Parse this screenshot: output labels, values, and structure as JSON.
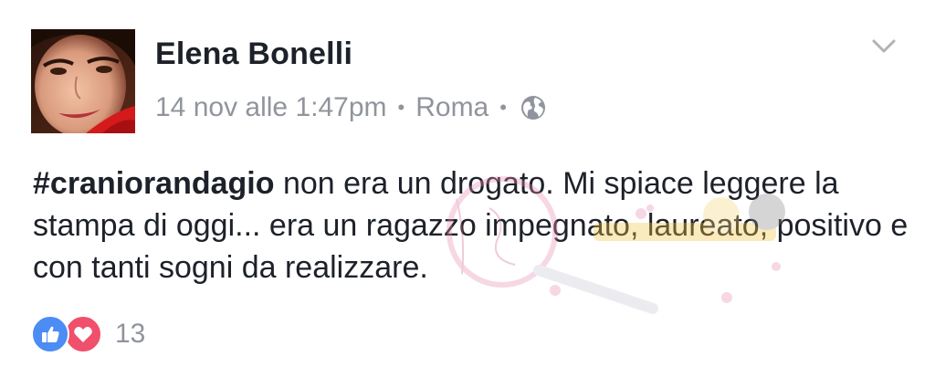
{
  "post": {
    "author_name": "Elena Bonelli",
    "date": "14 nov alle 1:47pm",
    "location": "Roma",
    "separator": "•",
    "privacy_icon": "globe-icon",
    "menu_icon": "chevron-down-icon",
    "hashtag": "#craniorandagio",
    "body_text": " non era un drogato. Mi spiace leggere la stampa di oggi... era un ragazzo impegnato, laureato, positivo e con tanti sogni da realizzare."
  },
  "reactions": {
    "icons": [
      "like-icon",
      "love-icon"
    ],
    "count": "13"
  },
  "colors": {
    "text": "#1d2129",
    "meta": "#90949c",
    "like": "#4b8cf5",
    "love": "#f0506c"
  }
}
